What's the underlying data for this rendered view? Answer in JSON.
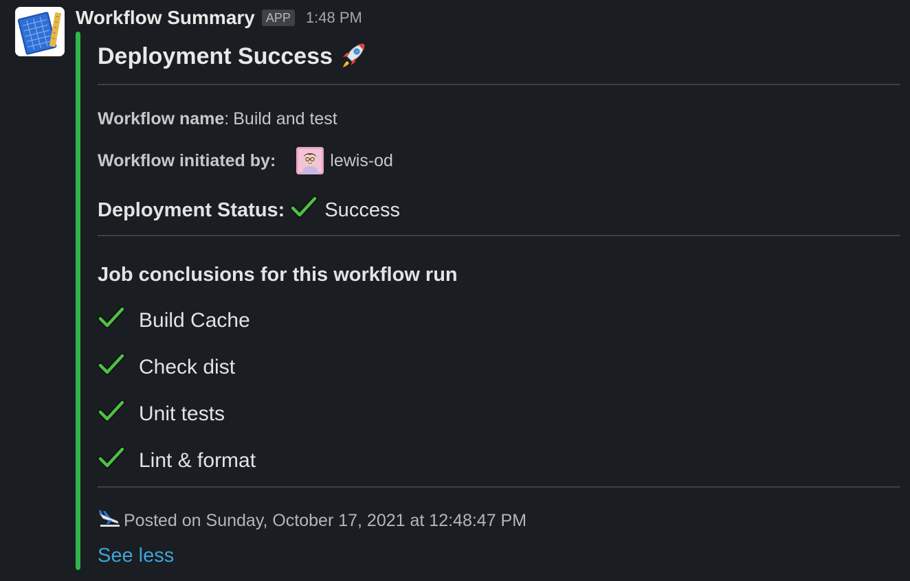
{
  "message": {
    "sender": "Workflow Summary",
    "badge": "APP",
    "time": "1:48 PM",
    "avatar_icon": "blueprint-ruler-icon"
  },
  "attachment": {
    "accent_color": "#2eb64a",
    "title": "Deployment Success",
    "title_icon": "rocket-icon",
    "workflow_name_label": "Workflow name",
    "workflow_name_sep": ":",
    "workflow_name_value": "Build and test",
    "initiated_by_label": "Workflow initiated by:",
    "initiated_by_user": "lewis-od",
    "initiated_by_avatar_icon": "user-avatar-icon",
    "status_label": "Deployment Status",
    "status_sep": ":",
    "status_icon": "check-mark-icon",
    "status_value": "Success",
    "jobs_title": "Job conclusions for this workflow run",
    "jobs": [
      {
        "name": "Build Cache",
        "icon": "check-mark-icon"
      },
      {
        "name": "Check dist",
        "icon": "check-mark-icon"
      },
      {
        "name": "Unit tests",
        "icon": "check-mark-icon"
      },
      {
        "name": "Lint & format",
        "icon": "check-mark-icon"
      }
    ],
    "footer_icon": "airplane-icon",
    "footer_text": "Posted on Sunday, October 17, 2021 at 12:48:47 PM",
    "see_less": "See less"
  }
}
